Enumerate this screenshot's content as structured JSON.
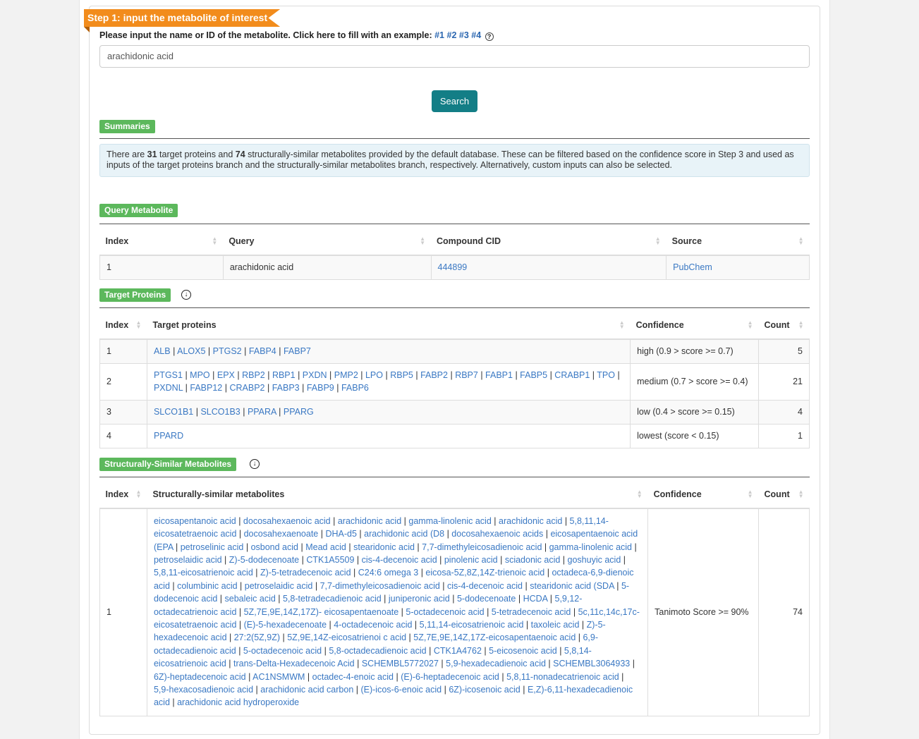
{
  "step1": {
    "title": "Step 1: input the metabolite of interest",
    "prompt": "Please input the name or ID of the metabolite. Click here to fill with an example:",
    "examples": [
      "#1",
      "#2",
      "#3",
      "#4"
    ],
    "help_icon": "?",
    "input_value": "arachidonic acid",
    "search_label": "Search"
  },
  "summaries": {
    "badge": "Summaries",
    "text_1": "There are ",
    "proteins_count": "31",
    "text_2": " target proteins and ",
    "metabolites_count": "74",
    "text_3": " structurally-similar metabolites provided by the default database. These can be filtered based on the confidence score in Step 3 and used as inputs of the target proteins branch and the structurally-similar metabolites branch, respectively. Alternatively, custom inputs can also be selected."
  },
  "query": {
    "badge": "Query Metabolite",
    "headers": [
      "Index",
      "Query",
      "Compound CID",
      "Source"
    ],
    "row": {
      "index": "1",
      "query": "arachidonic acid",
      "cid": "444899",
      "source": "PubChem"
    }
  },
  "targets": {
    "badge": "Target Proteins",
    "download_icon": "download-icon",
    "headers": [
      "Index",
      "Target proteins",
      "Confidence",
      "Count"
    ],
    "rows": [
      {
        "index": "1",
        "proteins": [
          "ALB",
          "ALOX5",
          "PTGS2",
          "FABP4",
          "FABP7"
        ],
        "confidence": "high (0.9 > score >= 0.7)",
        "count": "5"
      },
      {
        "index": "2",
        "proteins": [
          "PTGS1",
          "MPO",
          "EPX",
          "RBP2",
          "RBP1",
          "PXDN",
          "PMP2",
          "LPO",
          "RBP5",
          "FABP2",
          "RBP7",
          "FABP1",
          "FABP5",
          "CRABP1",
          "TPO",
          "PXDNL",
          "FABP12",
          "CRABP2",
          "FABP3",
          "FABP9",
          "FABP6"
        ],
        "confidence": "medium (0.7 > score >= 0.4)",
        "count": "21"
      },
      {
        "index": "3",
        "proteins": [
          "SLCO1B1",
          "SLCO1B3",
          "PPARA",
          "PPARG"
        ],
        "confidence": "low (0.4 > score >= 0.15)",
        "count": "4"
      },
      {
        "index": "4",
        "proteins": [
          "PPARD"
        ],
        "confidence": "lowest (score < 0.15)",
        "count": "1"
      }
    ]
  },
  "similar": {
    "badge": "Structurally-Similar Metabolites",
    "download_icon": "download-icon",
    "headers": [
      "Index",
      "Structurally-similar metabolites",
      "Confidence",
      "Count"
    ],
    "row": {
      "index": "1",
      "confidence": "Tanimoto Score >= 90%",
      "count": "74",
      "metabolites": [
        "eicosapentanoic acid",
        "docosahexaenoic acid",
        "arachidonic acid",
        "gamma-linolenic acid",
        "arachidonic acid",
        "5,8,11,14-eicosatetraenoic acid",
        "docosahexaenoate",
        "DHA-d5",
        "arachidonic acid (D8",
        "docosahexaenoic acids",
        "eicosapentaenoic acid (EPA",
        "petroselinic acid",
        "osbond acid",
        "Mead acid",
        "stearidonic acid",
        "7,7-dimethyleicosadienoic acid",
        "gamma-linolenic acid",
        "petroselaidic acid",
        "Z)-5-dodecenoate",
        "CTK1A5509",
        "cis-4-decenoic acid",
        "pinolenic acid",
        "sciadonic acid",
        "goshuyic acid",
        "5,8,11-eicosatrienoic acid",
        "Z)-5-tetradecenoic acid",
        "C24:6 omega 3",
        "eicosa-5Z,8Z,14Z-trienoic acid",
        "octadeca-6,9-dienoic acid",
        "columbinic acid",
        "petroselaidic acid",
        "7,7-dimethyleicosadienoic acid",
        "cis-4-decenoic acid",
        "stearidonic acid (SDA",
        "5-dodecenoic acid",
        "sebaleic acid",
        "5,8-tetradecadienoic acid",
        "juniperonic acid",
        "5-dodecenoate",
        "HCDA",
        "5,9,12-octadecatrienoic acid",
        "5Z,7E,9E,14Z,17Z)- eicosapentaenoate",
        "5-octadecenoic acid",
        "5-tetradecenoic acid",
        "5c,11c,14c,17c-eicosatetraenoic acid",
        "(E)-5-hexadecenoate",
        "4-octadecenoic acid",
        "5,11,14-eicosatrienoic acid",
        "taxoleic acid",
        "Z)-5-hexadecenoic acid",
        "27:2(5Z,9Z)",
        "5Z,9E,14Z-eicosatrienoi c acid",
        "5Z,7E,9E,14Z,17Z-eicosapentaenoic acid",
        "6,9-octadecadienoic acid",
        "5-octadecenoic acid",
        "5,8-octadecadienoic acid",
        "CTK1A4762",
        "5-eicosenoic acid",
        "5,8,14-eicosatrienoic acid",
        "trans-Delta-Hexadecenoic Acid",
        "SCHEMBL5772027",
        "5,9-hexadecadienoic acid",
        "SCHEMBL3064933",
        "6Z)-heptadecenoic acid",
        "AC1NSMWM",
        "octadec-4-enoic acid",
        "(E)-6-heptadecenoic acid",
        "5,8,11-nonadecatrienoic acid",
        "5,9-hexacosadienoic acid",
        "arachidonic acid carbon",
        "(E)-icos-6-enoic acid",
        "6Z)-icosenoic acid",
        "E,Z)-6,11-hexadecadienoic acid",
        "arachidonic acid hydroperoxide"
      ]
    }
  }
}
